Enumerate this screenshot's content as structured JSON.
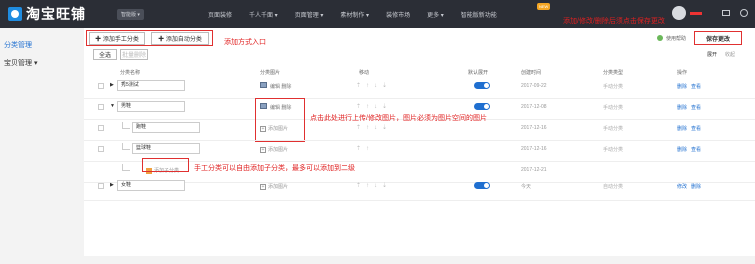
{
  "app": {
    "logo_text": "淘宝旺铺",
    "store_pill": "智能版 ▾",
    "nav": [
      "页面装修",
      "千人千面 ▾",
      "页面管理 ▾",
      "素材制作 ▾",
      "装修市场",
      "更多 ▾",
      "智能版新功能"
    ],
    "new_badge": "NEW",
    "top_annotation": "添加/修改/删除后须点击保存更改"
  },
  "sidebar": {
    "items": [
      "分类管理",
      "宝贝管理 ▾"
    ]
  },
  "toolbar": {
    "add_manual": "✚ 添加手工分类",
    "add_auto": "✚ 添加自动分类",
    "add_annotation": "添加方式入口",
    "select_all": "全选",
    "batch_delete": "批量删除",
    "help": "使用帮助",
    "save": "保存更改",
    "expand": "展开",
    "collapse": "收起"
  },
  "table": {
    "headers": [
      "分类名称",
      "分类图片",
      "移动",
      "默认展开",
      "创建时间",
      "分类类型",
      "操作"
    ],
    "image_annotation": "点击此处进行上传/修改图片，图片必须为图片空间的图片",
    "child_annotation": "手工分类可以自由添加子分类，最多可以添加到二级",
    "rows": [
      {
        "name": "秀5测试",
        "img": "编辑  删除",
        "date": "2017-09-22",
        "type": "手动分类",
        "ops": [
          "删除",
          "查看"
        ],
        "toggle": true
      },
      {
        "name": "男鞋",
        "img": "编辑  删除",
        "date": "2017-12-08",
        "type": "手动分类",
        "ops": [
          "删除",
          "查看"
        ],
        "toggle": true
      },
      {
        "name": "跑鞋",
        "img": "添加图片",
        "date": "2017-12-16",
        "type": "手动分类",
        "ops": [
          "删除",
          "查看"
        ],
        "toggle": false
      },
      {
        "name": "篮球鞋",
        "img": "添加图片",
        "date": "2017-12-16",
        "type": "手动分类",
        "ops": [
          "删除",
          "查看"
        ],
        "toggle": false
      },
      {
        "name": "添加子分类",
        "date": "2017-12-21"
      },
      {
        "name": "女鞋",
        "img": "添加图片",
        "date": "今天",
        "type": "自动分类",
        "ops": [
          "修改",
          "删除"
        ],
        "toggle": true
      }
    ]
  },
  "colors": {
    "accent": "#1f6fd0",
    "annotation": "#e02020",
    "topbar": "#2b2e36"
  }
}
